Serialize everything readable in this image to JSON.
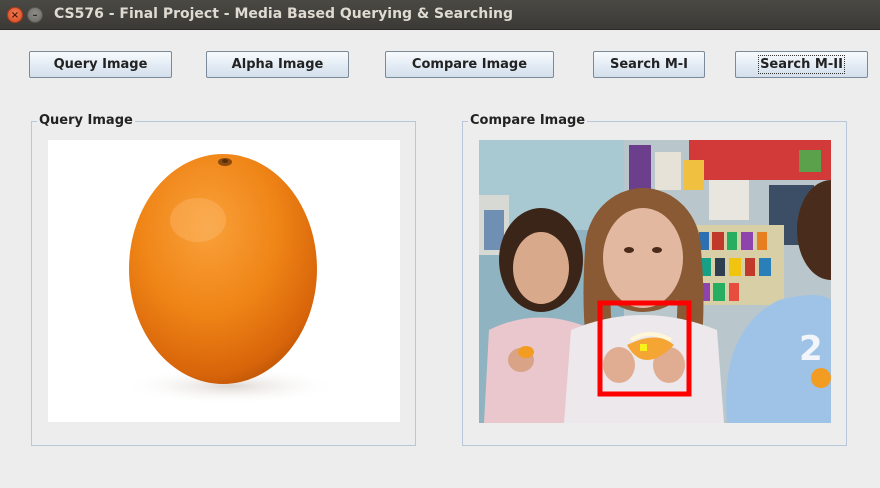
{
  "window": {
    "title": "CS576 - Final Project - Media Based Querying & Searching",
    "close_glyph": "×",
    "minimize_glyph": "–"
  },
  "toolbar": {
    "buttons": [
      {
        "label": "Query Image"
      },
      {
        "label": "Alpha Image"
      },
      {
        "label": "Compare Image"
      },
      {
        "label": "Search M-I"
      },
      {
        "label": "Search M-II"
      }
    ]
  },
  "query_panel": {
    "title": "Query Image",
    "image_icon": "orange-photo"
  },
  "compare_panel": {
    "title": "Compare Image",
    "image_icon": "classroom-children-photo",
    "match_box_color": "#ff0000"
  }
}
